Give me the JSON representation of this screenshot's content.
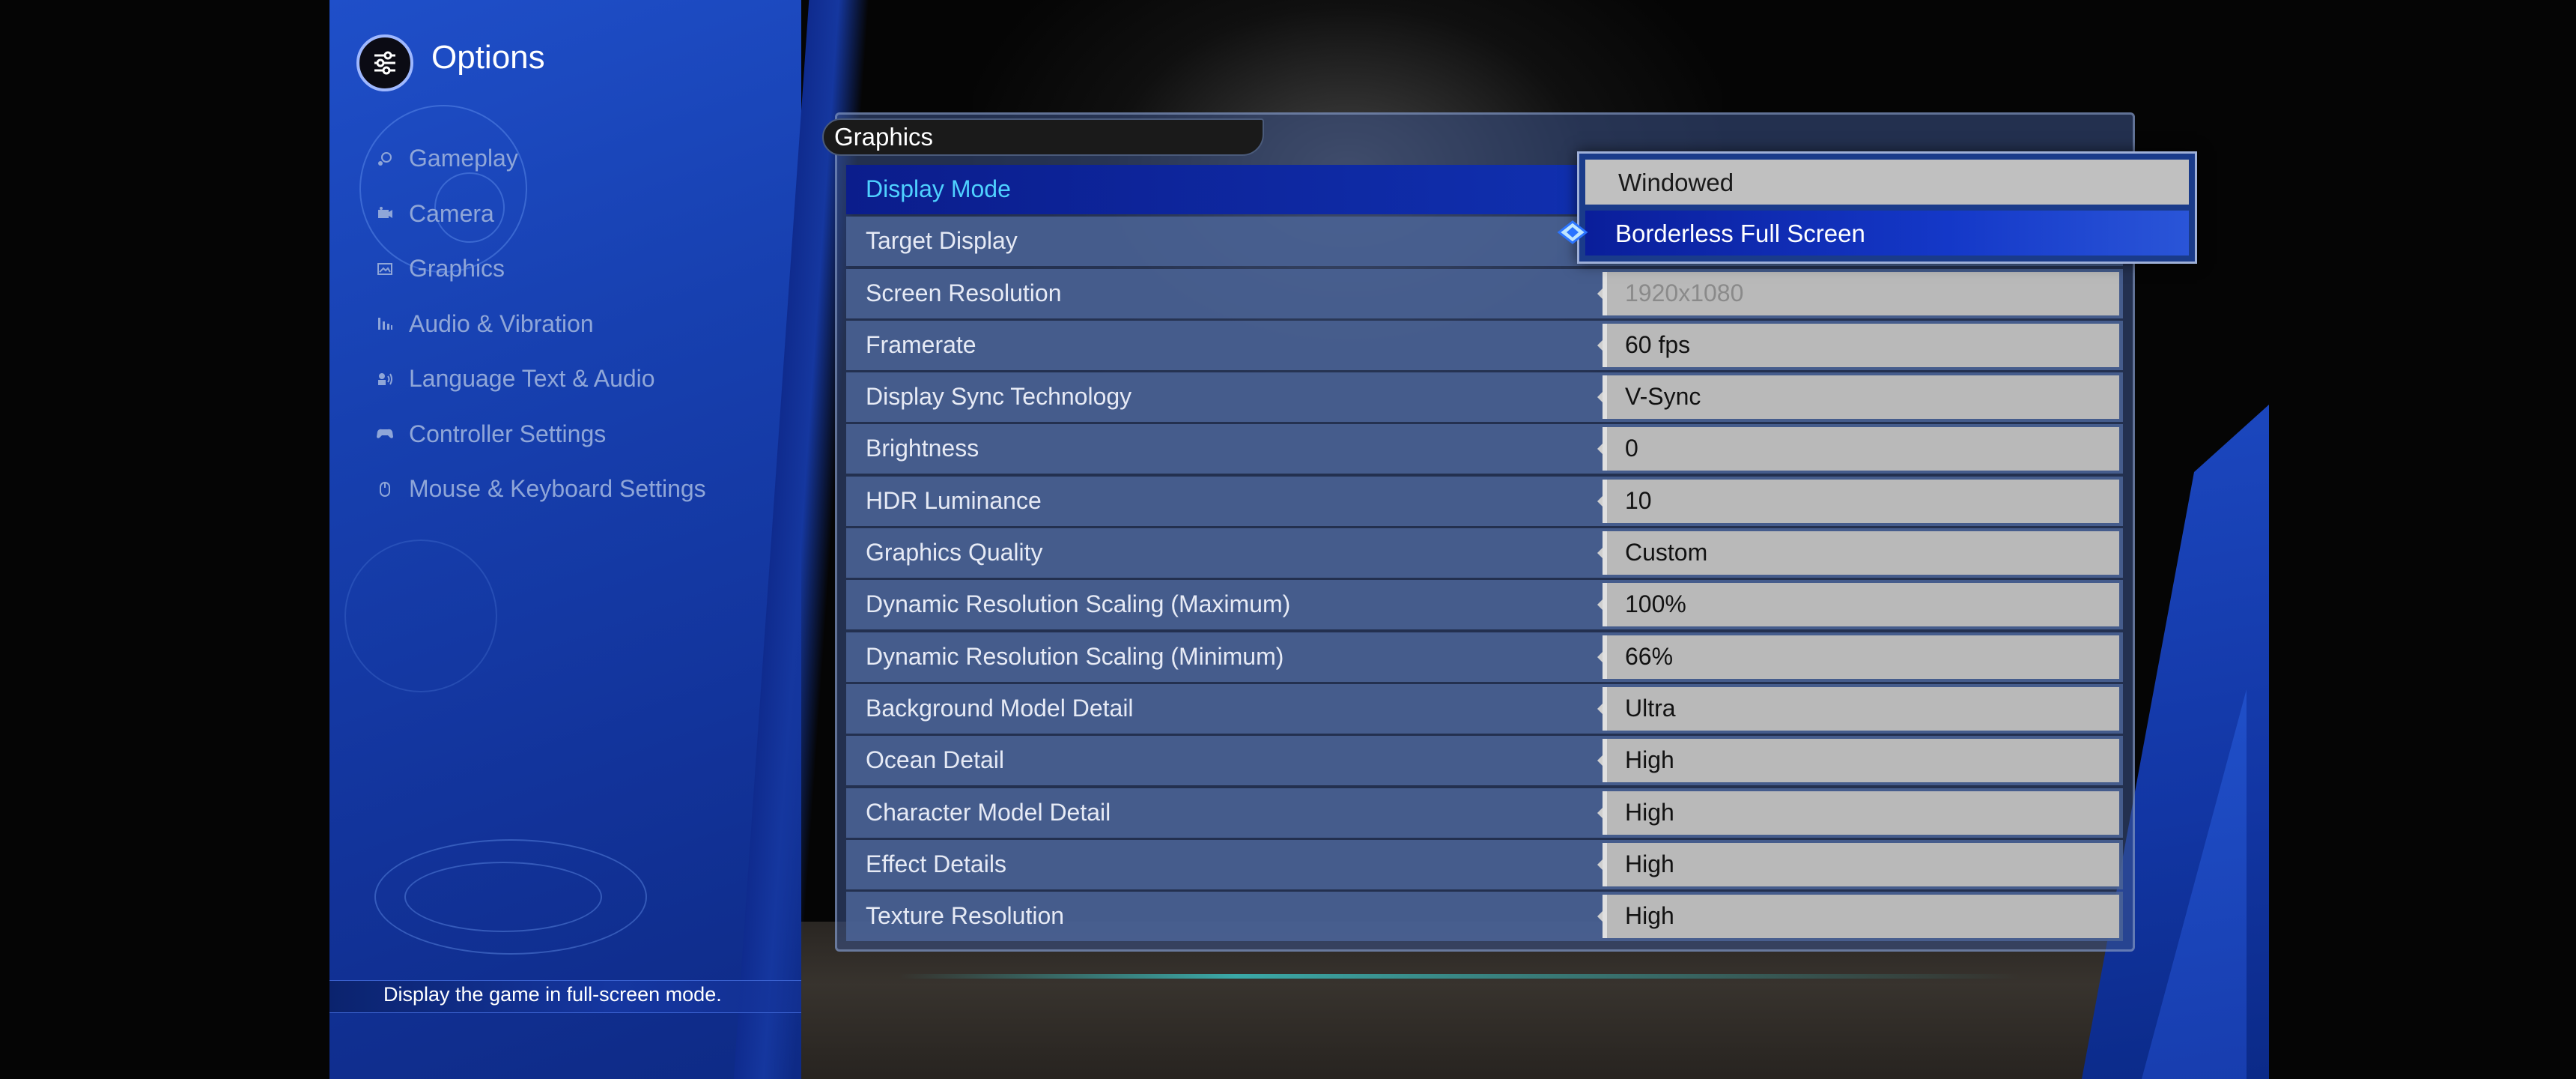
{
  "options": {
    "title": "Options"
  },
  "nav": {
    "items": [
      {
        "label": "Gameplay",
        "icon": "gameplay-icon"
      },
      {
        "label": "Camera",
        "icon": "camera-icon"
      },
      {
        "label": "Graphics",
        "icon": "graphics-icon"
      },
      {
        "label": "Audio & Vibration",
        "icon": "audio-icon"
      },
      {
        "label": "Language Text & Audio",
        "icon": "language-icon"
      },
      {
        "label": "Controller Settings",
        "icon": "controller-icon"
      },
      {
        "label": "Mouse & Keyboard Settings",
        "icon": "mouse-icon"
      }
    ]
  },
  "help": {
    "text": "Display the game in full-screen mode."
  },
  "section": {
    "title": "Graphics"
  },
  "settings": [
    {
      "label": "Display Mode",
      "value": ""
    },
    {
      "label": "Target Display",
      "value": ""
    },
    {
      "label": "Screen Resolution",
      "value": "1920x1080"
    },
    {
      "label": "Framerate",
      "value": "60 fps"
    },
    {
      "label": "Display Sync Technology",
      "value": "V-Sync"
    },
    {
      "label": "Brightness",
      "value": "0"
    },
    {
      "label": "HDR Luminance",
      "value": "10"
    },
    {
      "label": "Graphics Quality",
      "value": "Custom"
    },
    {
      "label": "Dynamic Resolution Scaling (Maximum)",
      "value": "100%"
    },
    {
      "label": "Dynamic Resolution Scaling (Minimum)",
      "value": "66%"
    },
    {
      "label": "Background Model Detail",
      "value": "Ultra"
    },
    {
      "label": "Ocean Detail",
      "value": "High"
    },
    {
      "label": "Character Model Detail",
      "value": "High"
    },
    {
      "label": "Effect Details",
      "value": "High"
    },
    {
      "label": "Texture Resolution",
      "value": "High"
    }
  ],
  "dropdown": {
    "options": [
      "Windowed",
      "Borderless Full Screen"
    ],
    "selected": "Borderless Full Screen"
  },
  "colors": {
    "accent": "#4fd1ff",
    "panel_blue": "#1740b0",
    "selected_row": "#1030b0"
  }
}
